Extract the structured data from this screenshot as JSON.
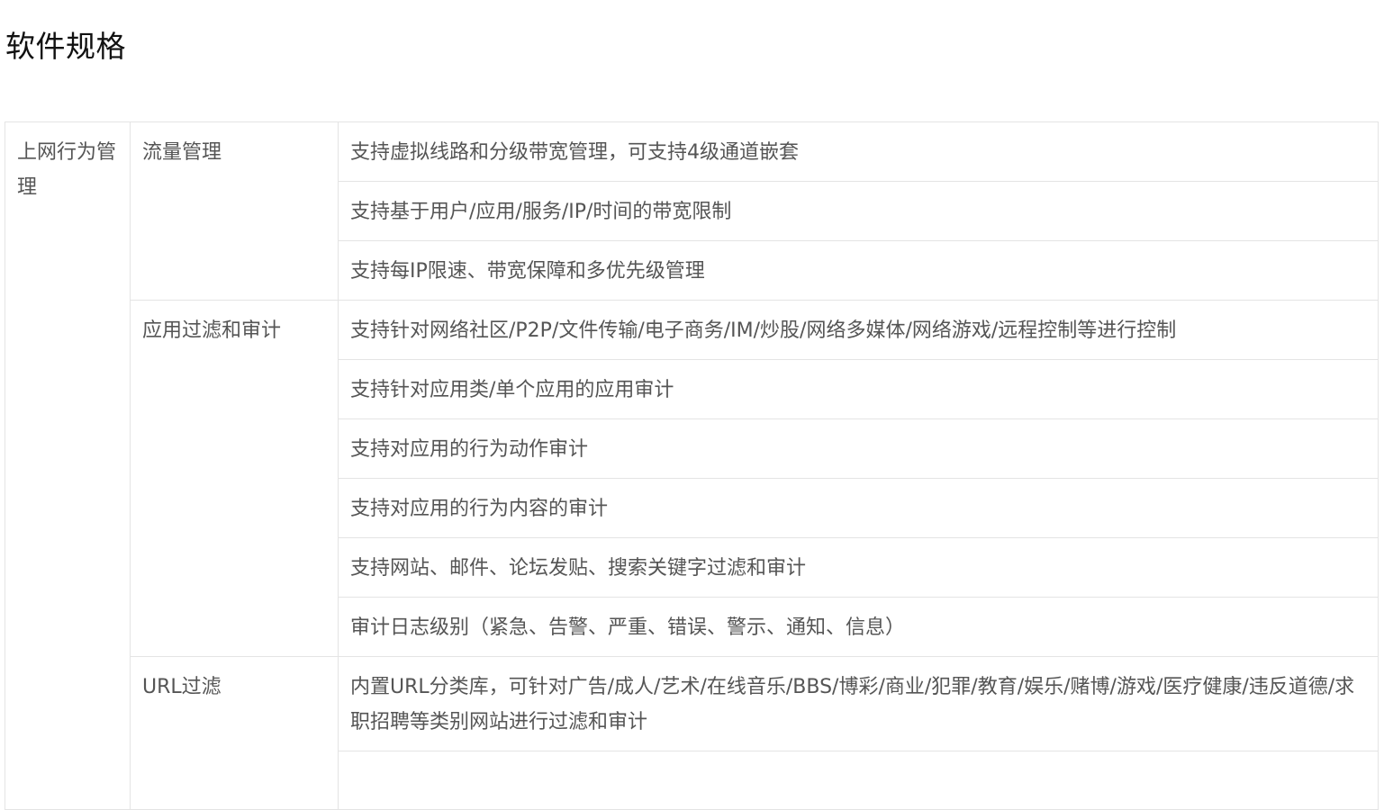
{
  "page": {
    "title": "软件规格"
  },
  "table": {
    "category": "上网行为管理",
    "groups": [
      {
        "name": "流量管理",
        "features": [
          "支持虚拟线路和分级带宽管理，可支持4级通道嵌套",
          "支持基于用户/应用/服务/IP/时间的带宽限制",
          "支持每IP限速、带宽保障和多优先级管理"
        ]
      },
      {
        "name": "应用过滤和审计",
        "features": [
          "支持针对网络社区/P2P/文件传输/电子商务/IM/炒股/网络多媒体/网络游戏/远程控制等进行控制",
          "支持针对应用类/单个应用的应用审计",
          "支持对应用的行为动作审计",
          "支持对应用的行为内容的审计",
          "支持网站、邮件、论坛发贴、搜索关键字过滤和审计",
          "审计日志级别（紧急、告警、严重、错误、警示、通知、信息）"
        ]
      },
      {
        "name": "URL过滤",
        "features": [
          "内置URL分类库，可针对广告/成人/艺术/在线音乐/BBS/博彩/商业/犯罪/教育/娱乐/赌博/游戏/医疗健康/违反道德/求职招聘等类别网站进行过滤和审计"
        ]
      }
    ]
  }
}
